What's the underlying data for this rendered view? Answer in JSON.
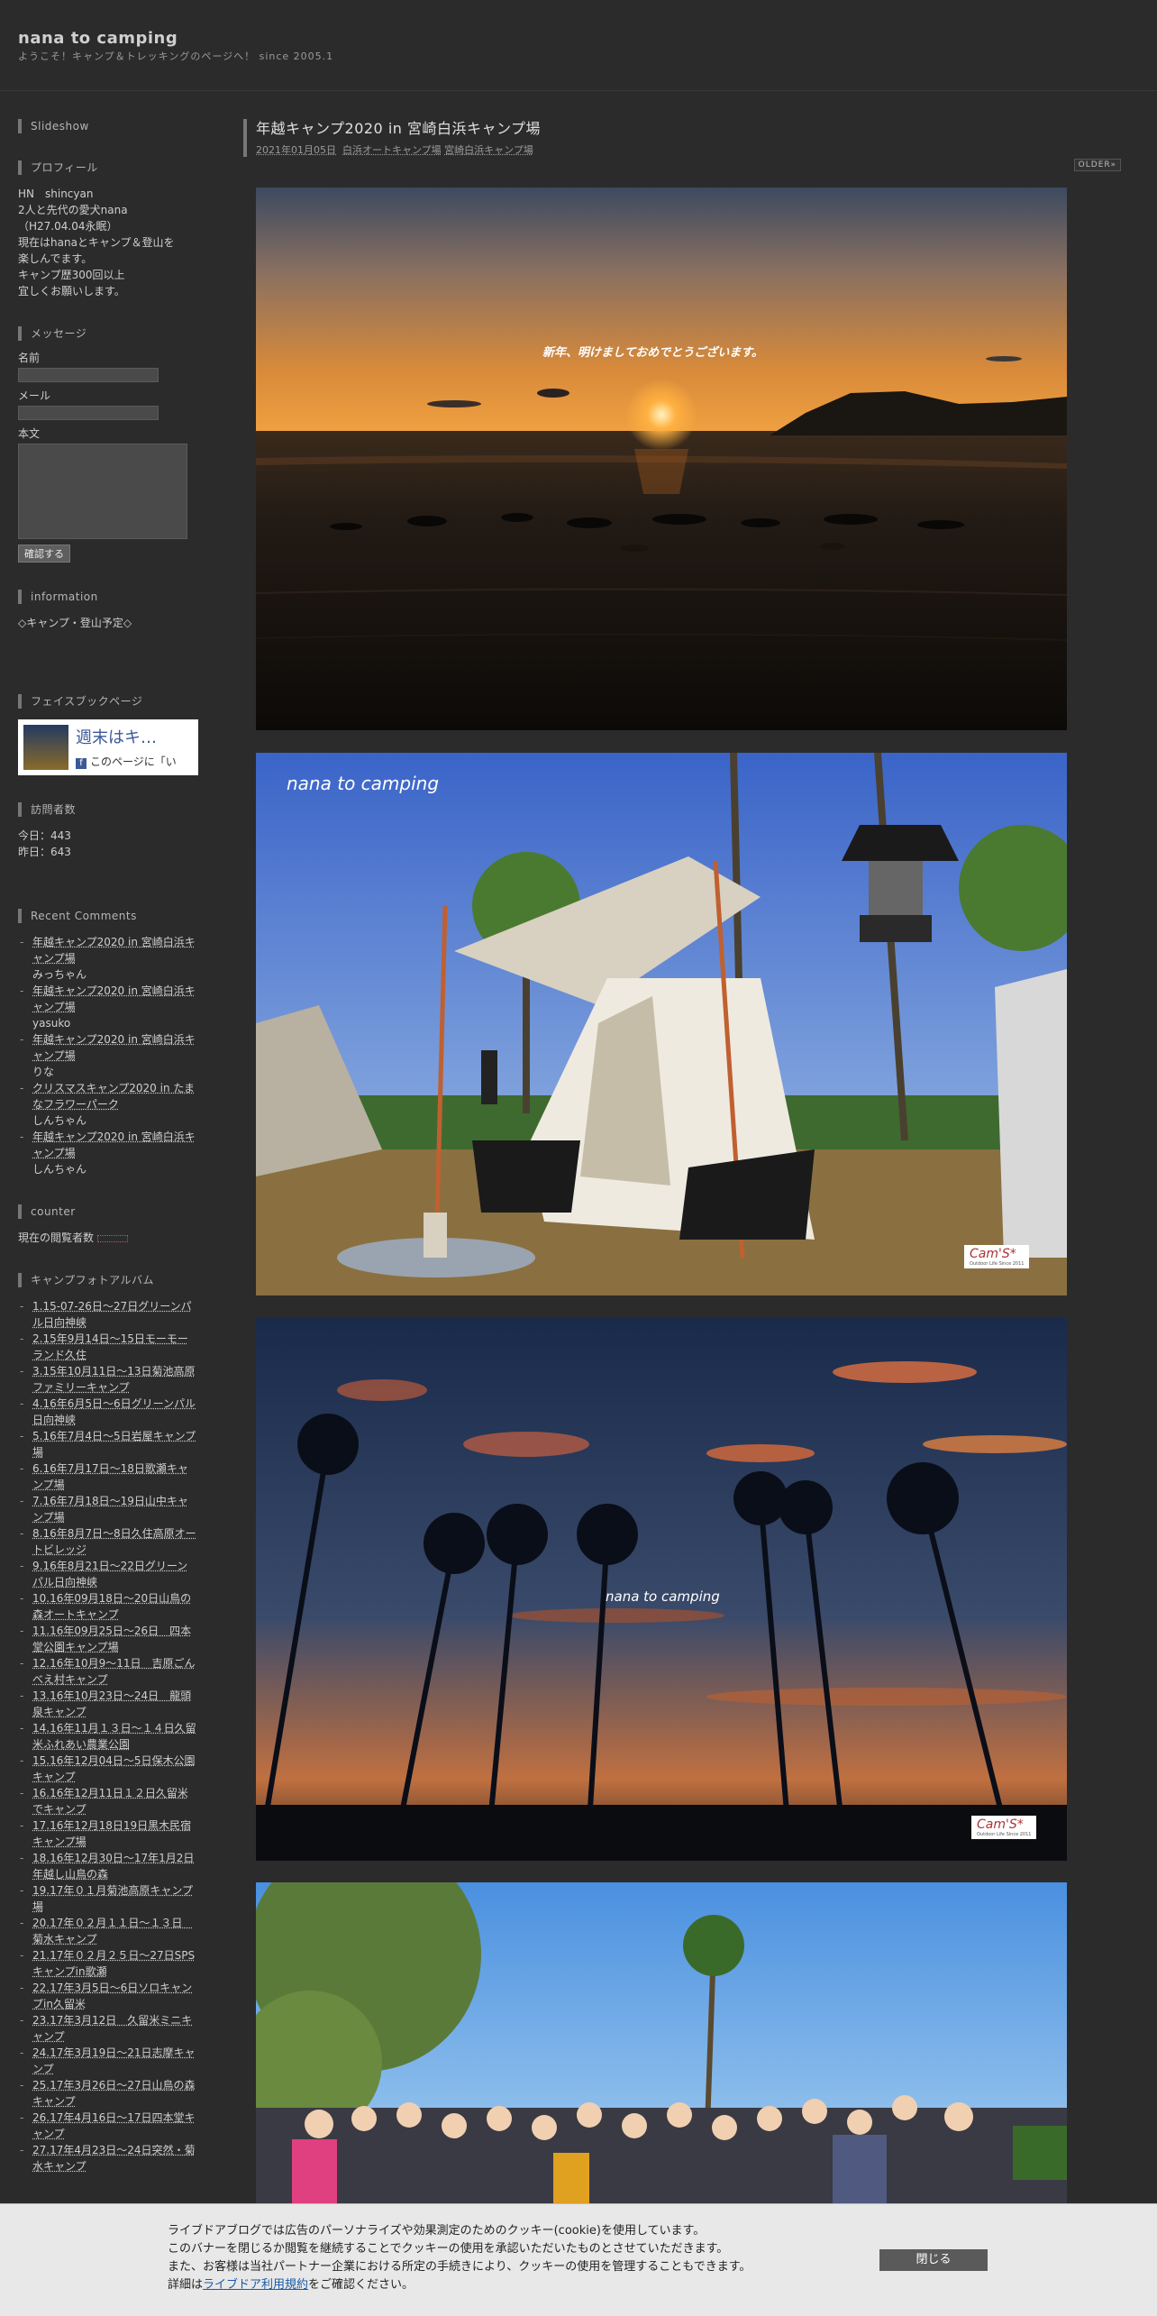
{
  "header": {
    "site_title": "nana to camping",
    "tagline": "ようこそ！キャンプ＆トレッキングのページへ！ since 2005.1"
  },
  "sidebar": {
    "slideshow": {
      "heading": "Slideshow"
    },
    "profile": {
      "heading": "プロフィール",
      "lines": [
        "HN　shincyan",
        "2人と先代の愛犬nana",
        "（H27.04.04永眠）",
        "現在はhanaとキャンプ＆登山を",
        "楽しんでます。",
        "キャンプ歴300回以上",
        "宜しくお願いします。"
      ]
    },
    "message": {
      "heading": "メッセージ",
      "name_label": "名前",
      "mail_label": "メール",
      "body_label": "本文",
      "confirm_button": "確認する"
    },
    "information": {
      "heading": "information",
      "text": "◇キャンプ・登山予定◇"
    },
    "facebook": {
      "heading": "フェイスブックページ",
      "page_name": "週末はキ…",
      "like_text": "このページに「い"
    },
    "visitors": {
      "heading": "訪問者数",
      "today": "今日：443",
      "yesterday": "昨日：643"
    },
    "recent_comments": {
      "heading": "Recent Comments",
      "items": [
        {
          "title": "年越キャンプ2020 in 宮崎白浜キャンプ場",
          "author": "みっちゃん"
        },
        {
          "title": "年越キャンプ2020 in 宮崎白浜キャンプ場",
          "author": "yasuko"
        },
        {
          "title": "年越キャンプ2020 in 宮崎白浜キャンプ場",
          "author": "りな"
        },
        {
          "title": "クリスマスキャンプ2020 in たまなフラワーパーク",
          "author": "しんちゃん"
        },
        {
          "title": "年越キャンプ2020 in 宮崎白浜キャンプ場",
          "author": "しんちゃん"
        }
      ]
    },
    "counter": {
      "heading": "counter",
      "text": "現在の閲覧者数"
    },
    "album": {
      "heading": "キャンプフォトアルバム",
      "items": [
        "1.15-07-26日～27日グリーンパル日向神峡",
        "2.15年9月14日～15日モーモーランド久住",
        "3.15年10月11日～13日菊池高原ファミリーキャンプ",
        "4.16年6月5日～6日グリーンパル日向神峡",
        "5.16年7月4日～5日岩屋キャンプ場",
        "6.16年7月17日～18日歌瀬キャンプ場",
        "7.16年7月18日～19日山中キャンプ場",
        "8.16年8月7日～8日久住高原オートビレッジ",
        "9.16年8月21日～22日グリーンパル日向神峡",
        "10.16年09月18日～20日山鳥の森オートキャンプ",
        "11.16年09月25日～26日　四本堂公園キャンプ場",
        "12.16年10月9～11日　吉原ごんべえ村キャンプ",
        "13.16年10月23日～24日　龍頭泉キャンプ",
        "14.16年11月１３日～１４日久留米ふれあい農業公園",
        "15.16年12月04日～5日保木公園キャンプ",
        "16.16年12月11日１２日久留米でキャンプ",
        "17.16年12月18日19日黒木民宿キャンプ場",
        "18.16年12月30日～17年1月2日年越し山鳥の森",
        "19.17年０１月菊池高原キャンプ場",
        "20.17年０２月１１日～１３日　菊水キャンプ",
        "21.17年０２月２５日～27日SPSキャンプin歌瀬",
        "22.17年3月5日～6日ソロキャンプin久留米",
        "23.17年3月12日　久留米ミニキャンプ",
        "24.17年3月19日～21日志摩キャンプ",
        "25.17年3月26日～27日山鳥の森キャンプ",
        "26.17年4月16日～17日四本堂キャンプ",
        "27.17年4月23日～24日突然・菊水キャンプ"
      ]
    }
  },
  "main": {
    "entry_title": "年越キャンプ2020 in 宮崎白浜キャンプ場",
    "entry_date": "2021年01月05日",
    "entry_categories": [
      "白浜オートキャンプ場",
      "宮崎白浜キャンプ場"
    ],
    "older_label": "OLDER»",
    "photos": [
      {
        "overlay": "新年、明けましておめでとうございます。"
      },
      {
        "overlay": "nana to camping",
        "watermark": "Cam'S*",
        "watermark_sub": "Outdoor Life Since 2011"
      },
      {
        "overlay": "nana to camping",
        "watermark": "Cam'S*",
        "watermark_sub": "Outdoor Life Since 2011"
      },
      {
        "overlay": ""
      }
    ]
  },
  "cookie_banner": {
    "line1": "ライブドアブログでは広告のパーソナライズや効果測定のためのクッキー(cookie)を使用しています。",
    "line2": "このバナーを閉じるか閲覧を継続することでクッキーの使用を承認いただいたものとさせていただきます。",
    "line3": "また、お客様は当社パートナー企業における所定の手続きにより、クッキーの使用を管理することもできます。",
    "line4_prefix": "詳細は",
    "line4_link": "ライブドア利用規約",
    "line4_suffix": "をご確認ください。",
    "close_button": "閉じる"
  }
}
